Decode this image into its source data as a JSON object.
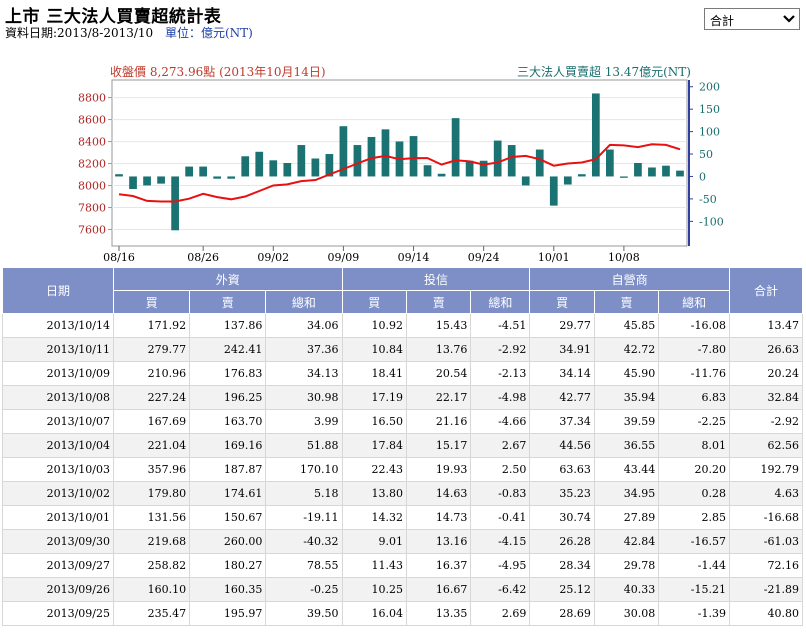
{
  "header": {
    "title": "上市 三大法人買賣超統計表",
    "date_range": "資料日期:2013/8-2013/10",
    "unit": "單位：億元(NT)"
  },
  "filter": {
    "selected": "合計"
  },
  "chart_data": {
    "type": "bar+line",
    "left_label": "收盤價 8,273.96點 (2013年10月14日)",
    "right_label": "三大法人買賣超 13.47億元(NT)",
    "left_axis": {
      "ticks": [
        7600,
        7800,
        8000,
        8200,
        8400,
        8600,
        8800
      ],
      "range": [
        7450,
        8960
      ]
    },
    "right_axis": {
      "ticks": [
        -100,
        -50,
        0,
        50,
        100,
        150,
        200
      ],
      "range": [
        -155,
        215
      ]
    },
    "x_tick_labels": [
      "08/16",
      "08/26",
      "09/02",
      "09/09",
      "09/14",
      "09/24",
      "10/01",
      "10/08"
    ],
    "x_tick_indices": [
      0,
      6,
      11,
      16,
      21,
      26,
      31,
      36
    ],
    "bar_color": "#1a7272",
    "line_color": "#e81010",
    "bars": [
      5,
      -28,
      -20,
      -16,
      -120,
      22,
      22,
      -5,
      -5,
      45,
      55,
      36,
      30,
      70,
      40,
      50,
      112,
      70,
      88,
      105,
      78,
      90,
      25,
      6,
      130,
      35,
      35,
      80,
      70,
      -20,
      60,
      -65,
      -18,
      5,
      185,
      60,
      -3,
      30,
      20,
      24,
      13
    ],
    "closes": [
      7920,
      7905,
      7860,
      7855,
      7855,
      7880,
      7925,
      7895,
      7875,
      7900,
      7950,
      8000,
      8010,
      8040,
      8050,
      8100,
      8150,
      8200,
      8250,
      8270,
      8240,
      8250,
      8250,
      8190,
      8230,
      8220,
      8190,
      8210,
      8260,
      8270,
      8240,
      8180,
      8200,
      8210,
      8240,
      8370,
      8365,
      8350,
      8375,
      8370,
      8330
    ]
  },
  "table": {
    "col_date": "日期",
    "groups": [
      "外資",
      "投信",
      "自營商"
    ],
    "col_total": "合計",
    "sub": [
      "買",
      "賣",
      "總和"
    ],
    "rows": [
      [
        "2013/10/14",
        "171.92",
        "137.86",
        "34.06",
        "10.92",
        "15.43",
        "-4.51",
        "29.77",
        "45.85",
        "-16.08",
        "13.47"
      ],
      [
        "2013/10/11",
        "279.77",
        "242.41",
        "37.36",
        "10.84",
        "13.76",
        "-2.92",
        "34.91",
        "42.72",
        "-7.80",
        "26.63"
      ],
      [
        "2013/10/09",
        "210.96",
        "176.83",
        "34.13",
        "18.41",
        "20.54",
        "-2.13",
        "34.14",
        "45.90",
        "-11.76",
        "20.24"
      ],
      [
        "2013/10/08",
        "227.24",
        "196.25",
        "30.98",
        "17.19",
        "22.17",
        "-4.98",
        "42.77",
        "35.94",
        "6.83",
        "32.84"
      ],
      [
        "2013/10/07",
        "167.69",
        "163.70",
        "3.99",
        "16.50",
        "21.16",
        "-4.66",
        "37.34",
        "39.59",
        "-2.25",
        "-2.92"
      ],
      [
        "2013/10/04",
        "221.04",
        "169.16",
        "51.88",
        "17.84",
        "15.17",
        "2.67",
        "44.56",
        "36.55",
        "8.01",
        "62.56"
      ],
      [
        "2013/10/03",
        "357.96",
        "187.87",
        "170.10",
        "22.43",
        "19.93",
        "2.50",
        "63.63",
        "43.44",
        "20.20",
        "192.79"
      ],
      [
        "2013/10/02",
        "179.80",
        "174.61",
        "5.18",
        "13.80",
        "14.63",
        "-0.83",
        "35.23",
        "34.95",
        "0.28",
        "4.63"
      ],
      [
        "2013/10/01",
        "131.56",
        "150.67",
        "-19.11",
        "14.32",
        "14.73",
        "-0.41",
        "30.74",
        "27.89",
        "2.85",
        "-16.68"
      ],
      [
        "2013/09/30",
        "219.68",
        "260.00",
        "-40.32",
        "9.01",
        "13.16",
        "-4.15",
        "26.28",
        "42.84",
        "-16.57",
        "-61.03"
      ],
      [
        "2013/09/27",
        "258.82",
        "180.27",
        "78.55",
        "11.43",
        "16.37",
        "-4.95",
        "28.34",
        "29.78",
        "-1.44",
        "72.16"
      ],
      [
        "2013/09/26",
        "160.10",
        "160.35",
        "-0.25",
        "10.25",
        "16.67",
        "-6.42",
        "25.12",
        "40.33",
        "-15.21",
        "-21.89"
      ],
      [
        "2013/09/25",
        "235.47",
        "195.97",
        "39.50",
        "16.04",
        "13.35",
        "2.69",
        "28.69",
        "30.08",
        "-1.39",
        "40.80"
      ]
    ]
  }
}
